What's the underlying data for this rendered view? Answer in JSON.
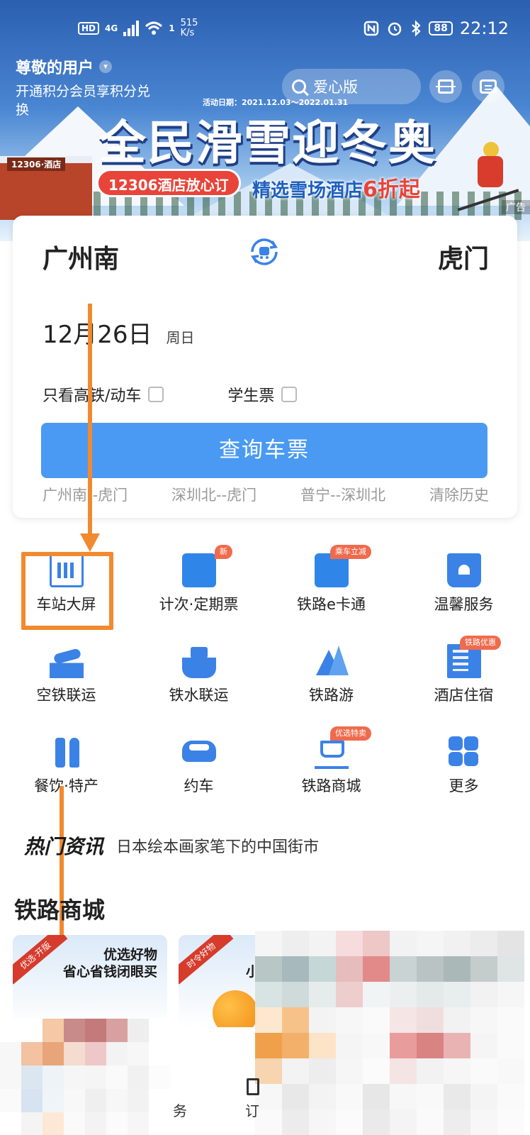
{
  "status_bar": {
    "hd": "HD",
    "signal": "4G",
    "signal_sup": "1",
    "net_speed_value": "515",
    "net_speed_unit": "K/s",
    "battery": "88",
    "time": "22:12"
  },
  "header": {
    "greeting": "尊敬的用户",
    "subtitle": "开通积分会员享积分兑换",
    "search_placeholder": "爱心版"
  },
  "banner": {
    "hotel_sign": "12306·酒店",
    "date_range": "活动日期：2021.12.03～2022.01.31",
    "title": "全民滑雪迎冬奥",
    "pill": "12306酒店放心订",
    "sub_prefix": "精选雪场酒店",
    "sub_highlight": "6折起",
    "ad": "广告"
  },
  "ticket": {
    "from": "广州南",
    "to": "虎门",
    "date": "12月26日",
    "weekday": "周日",
    "option_highspeed": "只看高铁/动车",
    "option_student": "学生票",
    "query_button": "查询车票",
    "history": [
      "广州南--虎门",
      "深圳北--虎门",
      "普宁--深圳北",
      "清除历史"
    ]
  },
  "services": [
    {
      "label": "车站大屏",
      "icon": "station-screen-icon",
      "tag": ""
    },
    {
      "label": "计次·定期票",
      "icon": "ticket-card-icon",
      "tag": "新"
    },
    {
      "label": "铁路e卡通",
      "icon": "e-card-icon",
      "tag": "乘车立减"
    },
    {
      "label": "温馨服务",
      "icon": "heart-service-icon",
      "tag": ""
    },
    {
      "label": "空铁联运",
      "icon": "plane-train-icon",
      "tag": ""
    },
    {
      "label": "铁水联运",
      "icon": "ship-train-icon",
      "tag": ""
    },
    {
      "label": "铁路游",
      "icon": "mountain-icon",
      "tag": ""
    },
    {
      "label": "酒店住宿",
      "icon": "hotel-icon",
      "tag": "铁路优惠"
    },
    {
      "label": "餐饮·特产",
      "icon": "food-icon",
      "tag": ""
    },
    {
      "label": "约车",
      "icon": "car-icon",
      "tag": ""
    },
    {
      "label": "铁路商城",
      "icon": "cart-icon",
      "tag": "优选特卖"
    },
    {
      "label": "更多",
      "icon": "more-grid-icon",
      "tag": ""
    }
  ],
  "news": {
    "tag": "热门资讯",
    "headline": "日本绘本画家笔下的中国街市"
  },
  "mall": {
    "title": "铁路商城",
    "card1_ribbon": "优选·开版",
    "card1_title": "优选好物",
    "card1_subtitle": "省心省钱闭眼买",
    "card2_ribbon": "时令好物",
    "card2_title_partial": "小"
  },
  "tab_bar": {
    "fragment_service": "务",
    "fragment_order": "订"
  },
  "colors": {
    "accent": "#4a9af3",
    "icon_blue": "#3b82e6",
    "tag_red": "#ef6b4d",
    "annotation_orange": "#f18a2f"
  }
}
